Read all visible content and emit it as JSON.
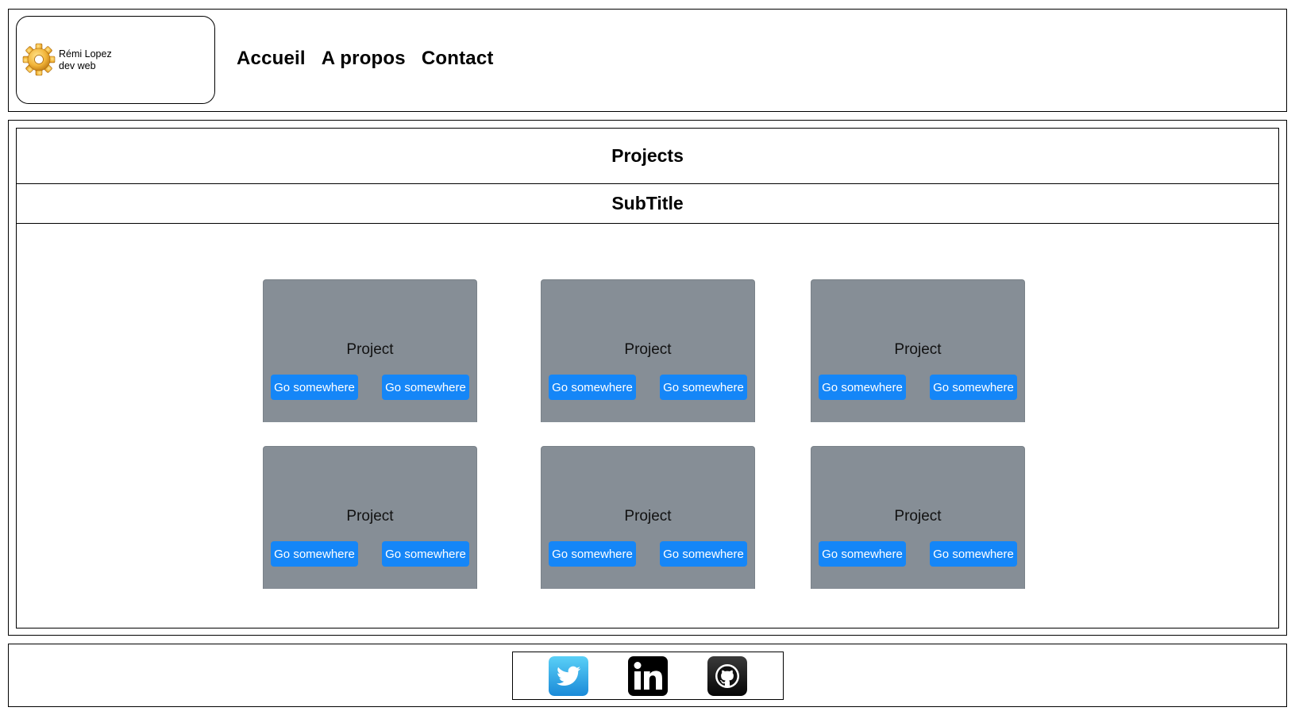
{
  "brand": {
    "name": "Rémi Lopez",
    "tagline": "dev web"
  },
  "nav": {
    "items": [
      "Accueil",
      "A propos",
      "Contact"
    ]
  },
  "main": {
    "title": "Projects",
    "subtitle": "SubTitle",
    "cards": [
      {
        "title": "Project",
        "buttons": [
          "Go somewhere",
          "Go somewhere"
        ]
      },
      {
        "title": "Project",
        "buttons": [
          "Go somewhere",
          "Go somewhere"
        ]
      },
      {
        "title": "Project",
        "buttons": [
          "Go somewhere",
          "Go somewhere"
        ]
      },
      {
        "title": "Project",
        "buttons": [
          "Go somewhere",
          "Go somewhere"
        ]
      },
      {
        "title": "Project",
        "buttons": [
          "Go somewhere",
          "Go somewhere"
        ]
      },
      {
        "title": "Project",
        "buttons": [
          "Go somewhere",
          "Go somewhere"
        ]
      }
    ]
  },
  "footer": {
    "social": [
      "twitter-icon",
      "linkedin-icon",
      "github-icon"
    ]
  },
  "colors": {
    "card_bg": "#868e96",
    "button_bg": "#1586f7",
    "twitter": "#1da1f2",
    "linkedin": "#000000",
    "github": "#111111"
  }
}
